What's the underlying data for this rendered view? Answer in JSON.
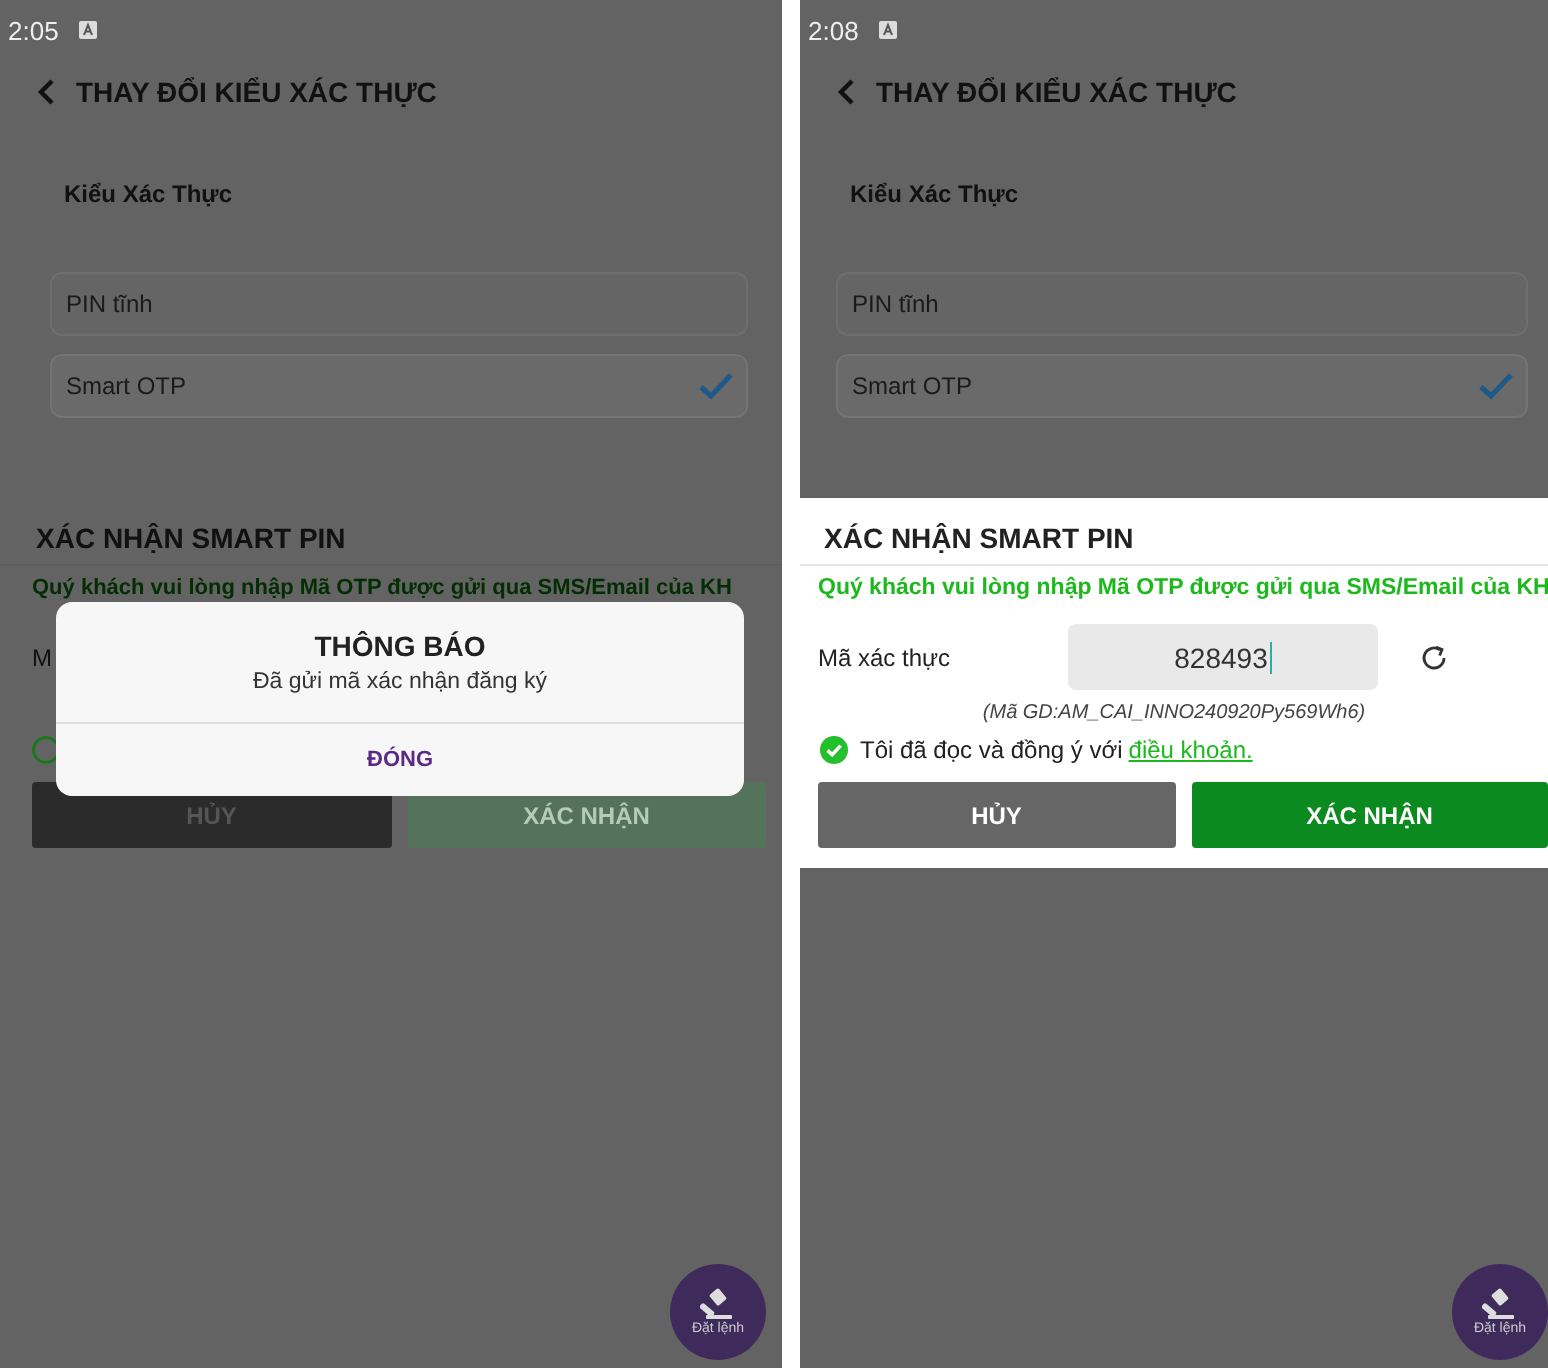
{
  "screens": [
    {
      "status_bar": {
        "time": "2:05"
      },
      "header": {
        "title": "THAY ĐỔI KIỂU XÁC THỰC"
      },
      "auth_type": {
        "label": "Kiểu Xác Thực",
        "options": [
          {
            "label": "PIN tĩnh",
            "selected": false
          },
          {
            "label": "Smart OTP",
            "selected": true
          }
        ]
      },
      "confirm_sheet": {
        "dimmed": true,
        "title": "XÁC NHẬN SMART PIN",
        "instruction": "Quý khách vui lòng nhập Mã OTP được gửi qua SMS/Email của KH",
        "field_label": "M",
        "agree": {
          "checked": false
        },
        "buttons": [
          {
            "kind": "cancel",
            "label": "HỦY"
          },
          {
            "kind": "confirm",
            "label": "XÁC NHẬN",
            "disabled": true
          }
        ]
      },
      "dialog": {
        "title": "THÔNG BÁO",
        "message": "Đã gửi mã xác nhận đăng ký",
        "button": "ĐÓNG"
      },
      "fab": {
        "label": "Đặt lệnh"
      }
    },
    {
      "status_bar": {
        "time": "2:08"
      },
      "header": {
        "title": "THAY ĐỔI KIỂU XÁC THỰC"
      },
      "auth_type": {
        "label": "Kiểu Xác Thực",
        "options": [
          {
            "label": "PIN tĩnh",
            "selected": false
          },
          {
            "label": "Smart OTP",
            "selected": true
          }
        ]
      },
      "confirm_sheet": {
        "dimmed": false,
        "title": "XÁC NHẬN SMART PIN",
        "instruction": "Quý khách vui lòng nhập Mã OTP được gửi qua SMS/Email của KH",
        "field_label": "Mã xác thực",
        "value": "828493",
        "transaction_code": "(Mã GD:AM_CAI_INNO240920Py569Wh6)",
        "agree": {
          "checked": true,
          "text": "Tôi đã đọc và đồng ý với",
          "link": "điều khoản."
        },
        "buttons": [
          {
            "kind": "cancel",
            "label": "HỦY"
          },
          {
            "kind": "confirm",
            "label": "XÁC NHẬN",
            "disabled": false
          }
        ]
      },
      "fab": {
        "label": "Đặt lệnh"
      }
    }
  ]
}
